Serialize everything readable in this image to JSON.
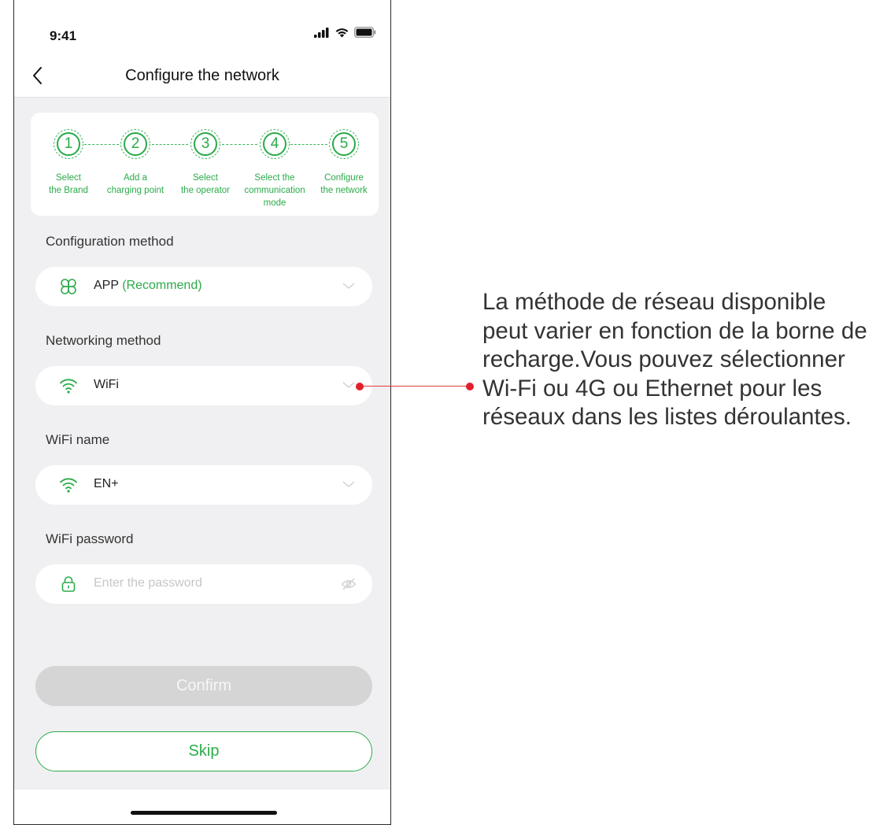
{
  "status_bar": {
    "time": "9:41"
  },
  "header": {
    "title": "Configure the network"
  },
  "steps": [
    {
      "number": "1",
      "label_line1": "Select",
      "label_line2": "the Brand",
      "label_line3": ""
    },
    {
      "number": "2",
      "label_line1": "Add a",
      "label_line2": "charging point",
      "label_line3": ""
    },
    {
      "number": "3",
      "label_line1": "Select",
      "label_line2": "the operator",
      "label_line3": ""
    },
    {
      "number": "4",
      "label_line1": "Select the",
      "label_line2": "communication",
      "label_line3": "mode"
    },
    {
      "number": "5",
      "label_line1": "Configure",
      "label_line2": "the network",
      "label_line3": ""
    }
  ],
  "config_method": {
    "label": "Configuration method",
    "value": "APP",
    "recommend": "(Recommend)"
  },
  "networking_method": {
    "label": "Networking method",
    "value": "WiFi"
  },
  "wifi_name": {
    "label": "WiFi name",
    "value": "EN+"
  },
  "wifi_password": {
    "label": "WiFi password",
    "placeholder": "Enter the password",
    "value": ""
  },
  "buttons": {
    "confirm": "Confirm",
    "skip": "Skip"
  },
  "annotation": {
    "text": "La méthode de réseau disponible peut varier en fonction de la borne de recharge.Vous pouvez sélectionner Wi-Fi ou 4G ou Ethernet pour les réseaux dans les listes déroulantes."
  },
  "colors": {
    "accent": "#2aab4a",
    "callout": "#e0202a",
    "background": "#f0f0f2",
    "disabled_button": "#d5d5d5"
  },
  "icons": {
    "config": "app-clover-icon",
    "network": "wifi-icon",
    "wifi_name": "wifi-icon",
    "password": "lock-icon",
    "visibility": "eye-off-icon",
    "dropdown": "chevron-down-icon",
    "back": "back-chevron-icon"
  }
}
